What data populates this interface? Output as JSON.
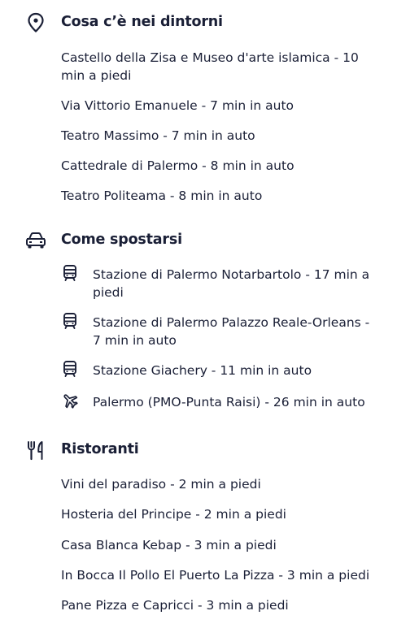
{
  "nearby": {
    "title": "Cosa c’è nei dintorni",
    "icon": "location-pin-icon",
    "items": [
      "Castello della Zisa e Museo d'arte islamica - 10 min a piedi",
      "Via Vittorio Emanuele - 7 min in auto",
      "Teatro Massimo - 7 min in auto",
      "Cattedrale di Palermo - 8 min in auto",
      "Teatro Politeama - 8 min in auto"
    ]
  },
  "transport": {
    "title": "Come spostarsi",
    "icon": "car-icon",
    "items": [
      {
        "icon": "train-icon",
        "label": "Stazione di Palermo Notarbartolo - 17 min a piedi"
      },
      {
        "icon": "train-icon",
        "label": "Stazione di Palermo Palazzo Reale-Orleans - 7 min in auto"
      },
      {
        "icon": "train-icon",
        "label": "Stazione Giachery - 11 min in auto"
      },
      {
        "icon": "airplane-icon",
        "label": "Palermo (PMO-Punta Raisi) - 26 min in auto"
      }
    ]
  },
  "restaurants": {
    "title": "Ristoranti",
    "icon": "fork-knife-icon",
    "items": [
      "Vini del paradiso - 2 min a piedi",
      "Hosteria del Principe - 2 min a piedi",
      "Casa Blanca Kebap - 3 min a piedi",
      "In Bocca Il Pollo El Puerto La Pizza - 3 min a piedi",
      "Pane Pizza e Capricci - 3 min a piedi"
    ]
  },
  "colors": {
    "text": "#1a1f36"
  }
}
